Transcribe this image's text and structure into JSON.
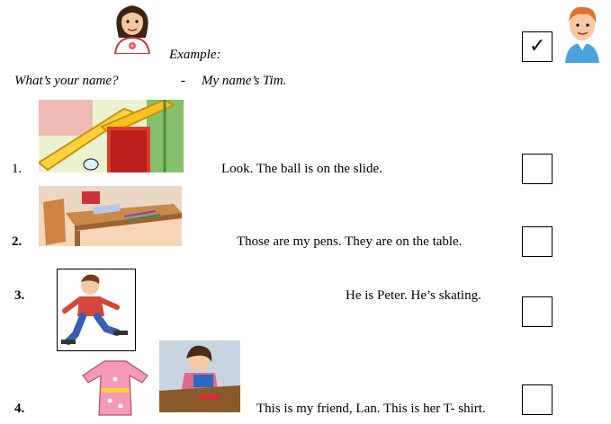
{
  "example": {
    "label": "Example:",
    "question": "What’s your name?",
    "dash": "-",
    "answer": "My name’s Tim.",
    "checkmark": "✓"
  },
  "items": [
    {
      "number": "1.",
      "sentence": "Look. The ball is on the slide."
    },
    {
      "number": "2.",
      "sentence": "Those are my pens. They are on the table."
    },
    {
      "number": "3.",
      "sentence": "He is Peter. He’s skating."
    },
    {
      "number": "4.",
      "sentence": "This is my friend, Lan. This is her T- shirt."
    }
  ]
}
